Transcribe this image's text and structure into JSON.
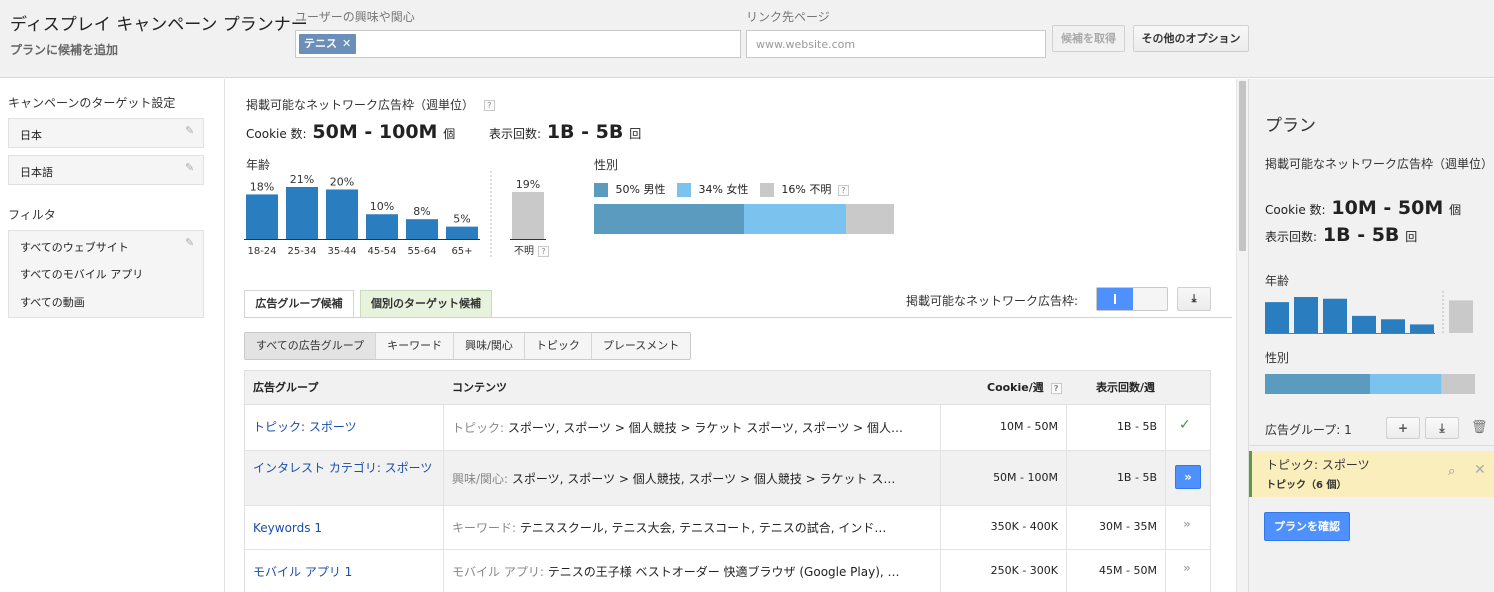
{
  "header": {
    "title": "ディスプレイ キャンペーン プランナー",
    "subtitle": "プランに候補を追加",
    "interest_label": "ユーザーの興味や関心",
    "interest_chip": "テニス",
    "interest_chip_remove": "✕",
    "link_label": "リンク先ページ",
    "link_placeholder": "www.website.com",
    "get_candidates_button": "候補を取得",
    "more_options_button": "その他のオプション"
  },
  "sidebar": {
    "targeting_title": "キャンペーンのターゲット設定",
    "targeting_items": [
      "日本",
      "日本語"
    ],
    "filter_title": "フィルタ",
    "filter_items": [
      "すべてのウェブサイト",
      "すべてのモバイル アプリ",
      "すべての動画"
    ]
  },
  "summary": {
    "title": "掲載可能なネットワーク広告枠（週単位）",
    "cookie_label": "Cookie 数:",
    "cookie_value": "50M - 100M",
    "cookie_unit": "個",
    "impressions_label": "表示回数:",
    "impressions_value": "1B - 5B",
    "impressions_unit": "回"
  },
  "age_chart": {
    "title": "年齢",
    "unknown_label": "不明",
    "unknown_value_label": "19%"
  },
  "gender_chart": {
    "title": "性別",
    "legend": [
      {
        "label": "50% 男性",
        "color": "#5b9bbf"
      },
      {
        "label": "34% 女性",
        "color": "#7bc3ee"
      },
      {
        "label": "16% 不明",
        "color": "#c9c9c9"
      }
    ]
  },
  "chart_data": [
    {
      "type": "bar",
      "title": "年齢",
      "categories": [
        "18-24",
        "25-34",
        "35-44",
        "45-54",
        "55-64",
        "65+",
        "不明"
      ],
      "values": [
        18,
        21,
        20,
        10,
        8,
        5,
        19
      ],
      "value_labels": [
        "18%",
        "21%",
        "20%",
        "10%",
        "8%",
        "5%",
        "19%"
      ],
      "colors": {
        "known": "#2a7dbf",
        "unknown": "#c9c9c9"
      }
    },
    {
      "type": "bar",
      "title": "性別",
      "categories": [
        "男性",
        "女性",
        "不明"
      ],
      "values": [
        50,
        34,
        16
      ],
      "stacked": true,
      "colors": [
        "#5b9bbf",
        "#7bc3ee",
        "#c9c9c9"
      ]
    }
  ],
  "tabs": [
    "広告グループ候補",
    "個別のターゲット候補"
  ],
  "toggle_label": "掲載可能なネットワーク広告枠:",
  "segments": [
    "すべての広告グループ",
    "キーワード",
    "興味/関心",
    "トピック",
    "プレースメント"
  ],
  "table": {
    "headers": {
      "name": "広告グループ",
      "content": "コンテンツ",
      "cookie": "Cookie/週",
      "impressions": "表示回数/週"
    },
    "rows": [
      {
        "name": "トピック: スポーツ",
        "type": "トピック:",
        "content": "スポーツ, スポーツ > 個人競技 > ラケット スポーツ, スポーツ > 個人…",
        "cookie": "10M - 50M",
        "impressions": "1B - 5B",
        "action": "✓"
      },
      {
        "name": "インタレスト カテゴリ: スポーツ",
        "type": "興味/関心:",
        "content": "スポーツ, スポーツ > 個人競技, スポーツ > 個人競技 > ラケット ス…",
        "cookie": "50M - 100M",
        "impressions": "1B - 5B",
        "action": "»"
      },
      {
        "name": "Keywords 1",
        "type": "キーワード:",
        "content": "テニススクール, テニス大会, テニスコート, テニスの試合, インド…",
        "cookie": "350K - 400K",
        "impressions": "30M - 35M",
        "action": "»"
      },
      {
        "name": "モバイル アプリ 1",
        "type": "モバイル アプリ:",
        "content": "テニスの王子様 ベストオーダー 快適ブラウザ (Google Play), …",
        "cookie": "250K - 300K",
        "impressions": "45M - 50M",
        "action": "»"
      }
    ]
  },
  "plan": {
    "title": "プラン",
    "inventory_title": "掲載可能なネットワーク広告枠（週単位）",
    "cookie_label": "Cookie 数:",
    "cookie_value": "10M - 50M",
    "cookie_unit": "個",
    "impressions_label": "表示回数:",
    "impressions_value": "1B - 5B",
    "impressions_unit": "回",
    "age_title": "年齢",
    "gender_title": "性別",
    "ad_groups_label": "広告グループ: 1",
    "item_name": "トピック: スポーツ",
    "item_sub": "トピック（6 個）",
    "confirm_button": "プランを確認"
  },
  "icons": [
    "pencil-icon",
    "help-icon",
    "download-icon",
    "add-icon",
    "trash-icon",
    "search-icon",
    "close-icon",
    "check-icon",
    "chevron-double-right-icon"
  ]
}
